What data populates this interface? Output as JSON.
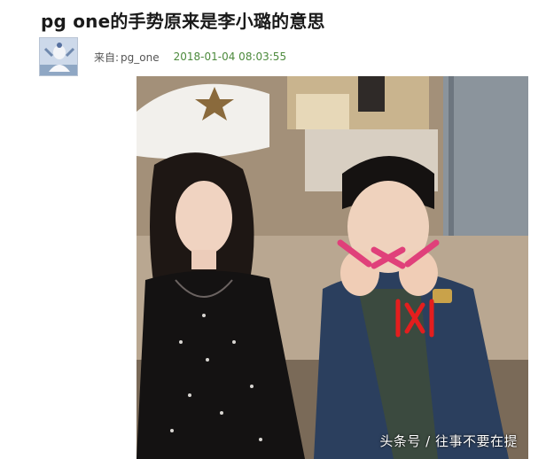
{
  "post": {
    "title": "pg one的手势原来是李小璐的意思",
    "source_label": "来自:",
    "source_name": "pg_one",
    "timestamp": "2018-01-04 08:03:55"
  },
  "avatar": {
    "icon": "user-avatar-icon"
  },
  "photo": {
    "watermark": "头条号 / 往事不要在提",
    "annotation": "|X|",
    "colors": {
      "highlight_x": "#e0407a",
      "annotation_red": "#e41e1e"
    }
  }
}
